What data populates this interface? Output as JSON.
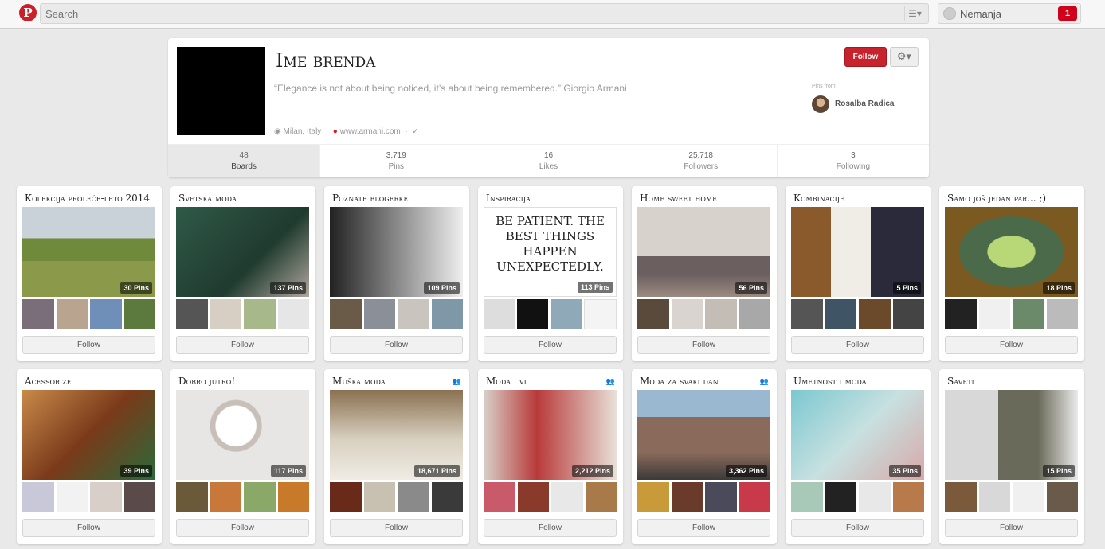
{
  "search": {
    "placeholder": "Search"
  },
  "user": {
    "name": "Nemanja",
    "notifications": "1"
  },
  "profile": {
    "name": "Ime brenda",
    "quote": "“Elegance is not about being noticed, it’s about being remembered.” Giorgio Armani",
    "location": "Milan, Italy",
    "website": "www.armani.com",
    "follow_label": "Follow",
    "pins_from_label": "Pins from",
    "curator": "Rosalba Radica",
    "stats": [
      {
        "num": "48",
        "label": "Boards"
      },
      {
        "num": "3,719",
        "label": "Pins"
      },
      {
        "num": "16",
        "label": "Likes"
      },
      {
        "num": "25,718",
        "label": "Followers"
      },
      {
        "num": "3",
        "label": "Following"
      }
    ]
  },
  "boards": [
    {
      "title": "Kolekcija proleće-leto 2014",
      "pins": "30 Pins",
      "follow": "Follow",
      "group": false
    },
    {
      "title": "Svetska moda",
      "pins": "137 Pins",
      "follow": "Follow",
      "group": false
    },
    {
      "title": "Poznate blogerke",
      "pins": "109 Pins",
      "follow": "Follow",
      "group": false
    },
    {
      "title": "Inspiracija",
      "pins": "113 Pins",
      "follow": "Follow",
      "group": false,
      "cover_text": "BE PATIENT. THE BEST THINGS HAPPEN UNEXPECTEDLY."
    },
    {
      "title": "Home sweet home",
      "pins": "56 Pins",
      "follow": "Follow",
      "group": false
    },
    {
      "title": "Kombinacije",
      "pins": "5 Pins",
      "follow": "Follow",
      "group": false
    },
    {
      "title": "Samo još jedan par... ;)",
      "pins": "18 Pins",
      "follow": "Follow",
      "group": false
    },
    {
      "title": "Acessorize",
      "pins": "39 Pins",
      "follow": "Follow",
      "group": false
    },
    {
      "title": "Dobro jutro!",
      "pins": "117 Pins",
      "follow": "Follow",
      "group": false
    },
    {
      "title": "Muška moda",
      "pins": "18,671 Pins",
      "follow": "Follow",
      "group": true
    },
    {
      "title": "Moda i vi",
      "pins": "2,212 Pins",
      "follow": "Follow",
      "group": true
    },
    {
      "title": "Moda za svaki dan",
      "pins": "3,362 Pins",
      "follow": "Follow",
      "group": true
    },
    {
      "title": "Umetnost i moda",
      "pins": "35 Pins",
      "follow": "Follow",
      "group": false
    },
    {
      "title": "Saveti",
      "pins": "15 Pins",
      "follow": "Follow",
      "group": false
    }
  ]
}
